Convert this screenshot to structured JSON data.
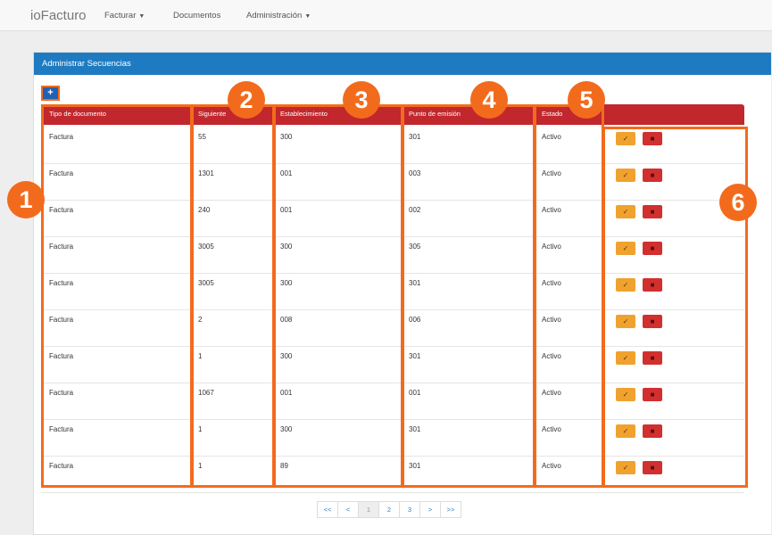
{
  "navbar": {
    "brand": "ioFacturo",
    "items": [
      {
        "label": "Facturar",
        "dropdown": true
      },
      {
        "label": "Documentos",
        "dropdown": false
      },
      {
        "label": "Administración",
        "dropdown": true
      }
    ]
  },
  "panel": {
    "title": "Administrar Secuencias",
    "add_label": "+"
  },
  "table": {
    "headers": [
      "Tipo de documento",
      "Siguiente",
      "Establecimiento",
      "Punto de emisión",
      "Estado",
      ""
    ],
    "rows": [
      [
        "Factura",
        "55",
        "300",
        "301",
        "Activo"
      ],
      [
        "Factura",
        "1301",
        "001",
        "003",
        "Activo"
      ],
      [
        "Factura",
        "240",
        "001",
        "002",
        "Activo"
      ],
      [
        "Factura",
        "3005",
        "300",
        "305",
        "Activo"
      ],
      [
        "Factura",
        "3005",
        "300",
        "301",
        "Activo"
      ],
      [
        "Factura",
        "2",
        "008",
        "006",
        "Activo"
      ],
      [
        "Factura",
        "1",
        "300",
        "301",
        "Activo"
      ],
      [
        "Factura",
        "1067",
        "001",
        "001",
        "Activo"
      ],
      [
        "Factura",
        "1",
        "300",
        "301",
        "Activo"
      ],
      [
        "Factura",
        "1",
        "89",
        "301",
        "Activo"
      ]
    ],
    "actions": {
      "edit_icon": "edit-icon",
      "delete_icon": "trash-icon"
    }
  },
  "annotations": [
    "1",
    "2",
    "3",
    "4",
    "5",
    "6"
  ],
  "pagination": {
    "items": [
      "<<",
      "<",
      "1",
      "2",
      "3",
      ">",
      ">>"
    ],
    "active": "1"
  },
  "colors": {
    "heading": "#1f7bc1",
    "table_header": "#c1272d",
    "highlight": "#f26b1d",
    "edit_button": "#f0a22e",
    "delete_button": "#d22f2f"
  }
}
